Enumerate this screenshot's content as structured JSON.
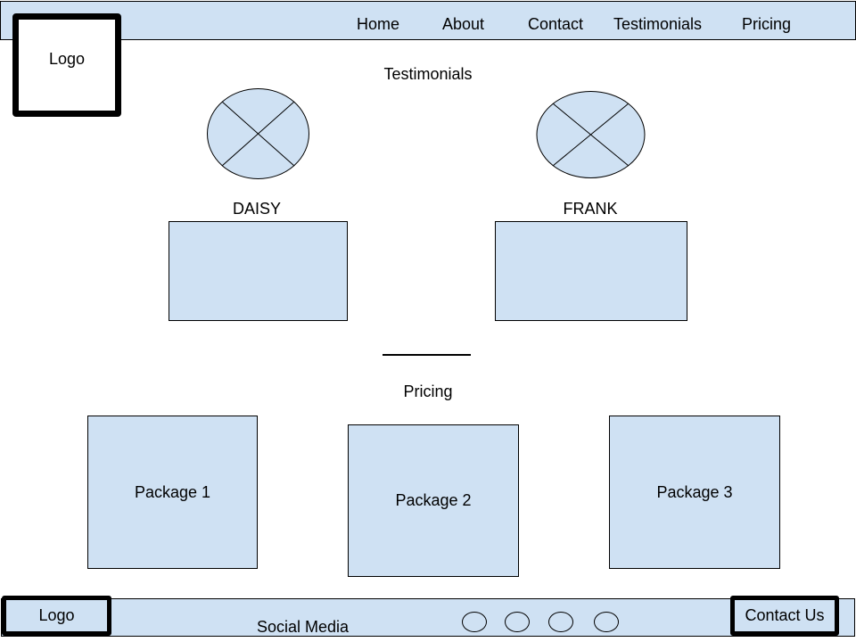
{
  "header": {
    "logo": "Logo",
    "nav": [
      "Home",
      "About",
      "Contact",
      "Testimonials",
      "Pricing"
    ]
  },
  "testimonials": {
    "title": "Testimonials",
    "people": [
      {
        "name": "DAISY",
        "avatar_icon": "image-placeholder-icon"
      },
      {
        "name": "FRANK",
        "avatar_icon": "image-placeholder-icon"
      }
    ]
  },
  "pricing": {
    "title": "Pricing",
    "packages": [
      "Package 1",
      "Package 2",
      "Package 3"
    ]
  },
  "footer": {
    "logo": "Logo",
    "social_label": "Social Media",
    "social_icons": [
      "social-icon",
      "social-icon",
      "social-icon",
      "social-icon"
    ],
    "contact_button": "Contact Us"
  },
  "colors": {
    "fill": "#cfe1f3",
    "border": "#000000"
  }
}
